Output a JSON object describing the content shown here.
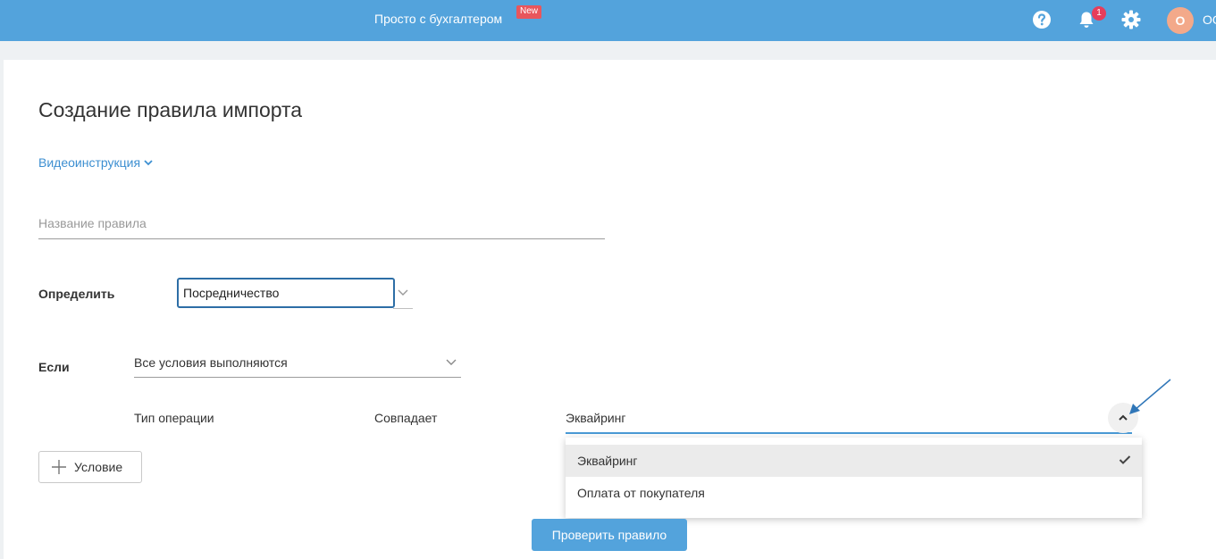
{
  "header": {
    "promo_label": "Просто с бухгалтером",
    "new_badge": "New",
    "notifications_count": "1",
    "avatar_letter": "О",
    "org_name": "ОО"
  },
  "page": {
    "title": "Создание правила импорта",
    "video_link": "Видеоинструкция"
  },
  "form": {
    "rule_name_placeholder": "Название правила",
    "define_label": "Определить",
    "define_value": "Посредничество",
    "if_label": "Если",
    "conditions_mode": "Все условия выполняются",
    "condition": {
      "field": "Тип операции",
      "operator": "Совпадает",
      "value": "Эквайринг"
    },
    "dropdown_options": [
      "Эквайринг",
      "Оплата от покупателя"
    ],
    "selected_option_index": 0,
    "add_condition_label": "Условие",
    "check_rule_label": "Проверить правило"
  },
  "colors": {
    "brand_blue": "#53a3dc",
    "link_blue": "#3d8fd1",
    "badge_red": "#e8565c",
    "focus_border": "#2d6ea6"
  }
}
